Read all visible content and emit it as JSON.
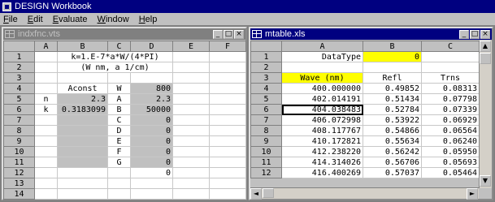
{
  "app": {
    "title": "DESIGN Workbook"
  },
  "menu": [
    {
      "label": "File",
      "key": "F",
      "rest": "ile"
    },
    {
      "label": "Edit",
      "key": "E",
      "rest": "dit"
    },
    {
      "label": "Evaluate",
      "key": "E",
      "rest": "valuate"
    },
    {
      "label": "Window",
      "key": "W",
      "rest": "indow"
    },
    {
      "label": "Help",
      "key": "H",
      "rest": "elp"
    }
  ],
  "left_window": {
    "title": "indxfnc.vts",
    "columns": [
      "A",
      "B",
      "C",
      "D",
      "E",
      "F"
    ],
    "rows": [
      {
        "n": "1",
        "cells": [
          "",
          "k=1.E-7*a*W/(4*PI)",
          "",
          "",
          "",
          ""
        ]
      },
      {
        "n": "2",
        "cells": [
          "",
          "(W nm, a 1/cm)",
          "",
          "",
          "",
          ""
        ]
      },
      {
        "n": "3",
        "cells": [
          "",
          "",
          "",
          "",
          "",
          ""
        ]
      },
      {
        "n": "4",
        "cells": [
          "",
          "Aconst",
          "W",
          "800",
          "",
          ""
        ]
      },
      {
        "n": "5",
        "cells": [
          "n",
          "2.3",
          "A",
          "2.3",
          "",
          ""
        ]
      },
      {
        "n": "6",
        "cells": [
          "k",
          "0.3183099",
          "B",
          "50000",
          "",
          ""
        ]
      },
      {
        "n": "7",
        "cells": [
          "",
          "",
          "C",
          "0",
          "",
          ""
        ]
      },
      {
        "n": "8",
        "cells": [
          "",
          "",
          "D",
          "0",
          "",
          ""
        ]
      },
      {
        "n": "9",
        "cells": [
          "",
          "",
          "E",
          "0",
          "",
          ""
        ]
      },
      {
        "n": "10",
        "cells": [
          "",
          "",
          "F",
          "0",
          "",
          ""
        ]
      },
      {
        "n": "11",
        "cells": [
          "",
          "",
          "G",
          "0",
          "",
          ""
        ]
      },
      {
        "n": "12",
        "cells": [
          "",
          "",
          "",
          "0",
          "",
          ""
        ]
      },
      {
        "n": "13",
        "cells": [
          "",
          "",
          "",
          "",
          "",
          ""
        ]
      },
      {
        "n": "14",
        "cells": [
          "",
          "",
          "",
          "",
          "",
          ""
        ]
      }
    ]
  },
  "right_window": {
    "title": "mtable.xls",
    "columns": [
      "A",
      "B",
      "C"
    ],
    "rows": [
      {
        "n": "1",
        "cells": [
          "DataType",
          "0",
          ""
        ]
      },
      {
        "n": "2",
        "cells": [
          "",
          "",
          ""
        ]
      },
      {
        "n": "3",
        "cells": [
          "Wave (nm)",
          "Refl",
          "Trns"
        ]
      },
      {
        "n": "4",
        "cells": [
          "400.000000",
          "0.49852",
          "0.08313"
        ]
      },
      {
        "n": "5",
        "cells": [
          "402.014191",
          "0.51434",
          "0.07798"
        ]
      },
      {
        "n": "6",
        "cells": [
          "404.038483",
          "0.52784",
          "0.07339"
        ]
      },
      {
        "n": "7",
        "cells": [
          "406.072998",
          "0.53922",
          "0.06929"
        ]
      },
      {
        "n": "8",
        "cells": [
          "408.117767",
          "0.54866",
          "0.06564"
        ]
      },
      {
        "n": "9",
        "cells": [
          "410.172821",
          "0.55634",
          "0.06240"
        ]
      },
      {
        "n": "10",
        "cells": [
          "412.238220",
          "0.56242",
          "0.05950"
        ]
      },
      {
        "n": "11",
        "cells": [
          "414.314026",
          "0.56706",
          "0.05693"
        ]
      },
      {
        "n": "12",
        "cells": [
          "416.400269",
          "0.57037",
          "0.05464"
        ]
      }
    ]
  },
  "buttons": {
    "min": "_",
    "max": "□",
    "close": "×"
  },
  "scroll_glyphs": {
    "up": "▲",
    "down": "▼",
    "left": "◄",
    "right": "►"
  }
}
